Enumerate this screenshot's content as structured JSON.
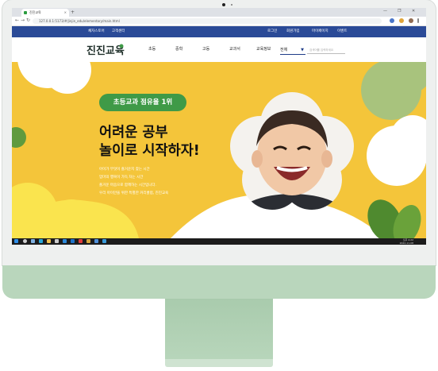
{
  "browser": {
    "tab_title": "진진교육",
    "tab_close": "×",
    "new_tab": "+",
    "window_controls": [
      "—",
      "❐",
      "✕"
    ],
    "url": "127.0.0.1:5173/#/jinjin_edu/elementary/main.html",
    "nav_icons": [
      "←",
      "→",
      "↻"
    ]
  },
  "site": {
    "top_links_left": [
      "채자스토어",
      "고객센터"
    ],
    "top_links_right": [
      "로그인",
      "회원가입",
      "마이페이지",
      "이벤트"
    ],
    "logo_text": "진진교육",
    "menu": [
      "초등",
      "중학",
      "고등",
      "교과서",
      "교육정보"
    ],
    "select_value": "전체",
    "select_arrow": "▼",
    "search_placeholder": "검색어를 입력하세요"
  },
  "hero": {
    "badge": "초등교과 점유율 1위",
    "title_line1": "어려운 공부",
    "title_line2": "놀이로 시작하자!",
    "desc": [
      "아이가 무엇이 즐거운지 찾는 시간",
      "엄마의 행복이 가득 차는 시간",
      "즐거운 마음으로 함께하는 시간입니다.",
      "우리 아이만을 위한 특별한 커리큘럼, 진진교육"
    ]
  },
  "taskbar": {
    "time": "오후 4:22",
    "date": "2022-11-08"
  },
  "colors": {
    "hero_yellow": "#f4c53a",
    "badge_green": "#3f9a47",
    "topstrip_blue": "#2a4a97",
    "imac_green": "#b9d6bc"
  }
}
